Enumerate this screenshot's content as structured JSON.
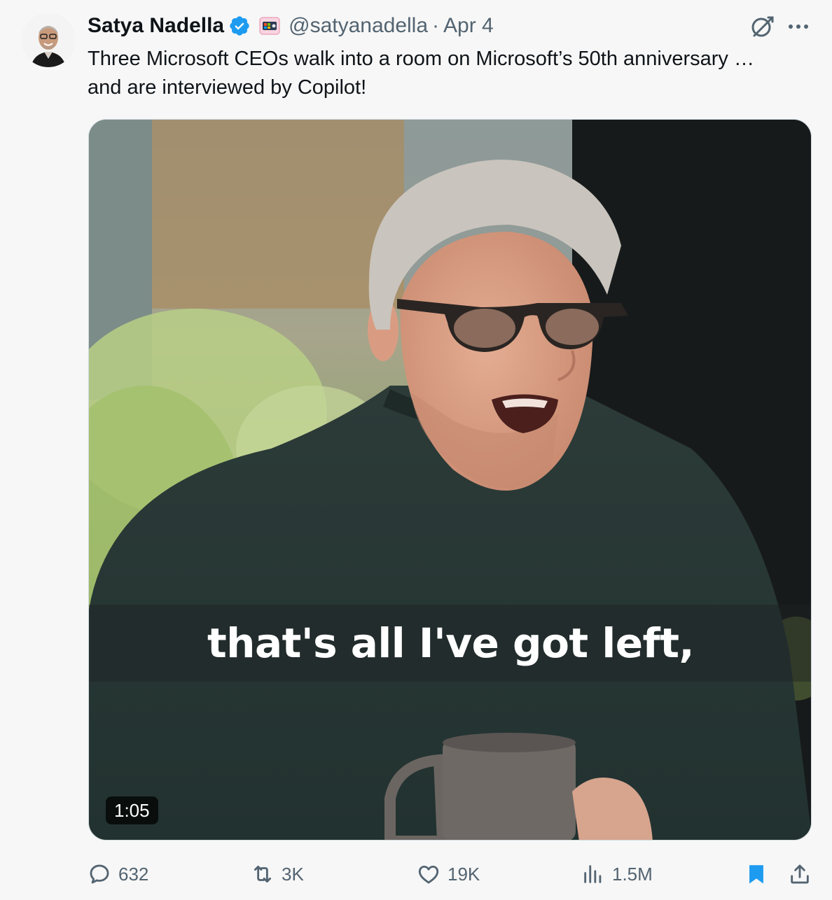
{
  "author": {
    "name": "Satya Nadella",
    "handle": "@satyanadella",
    "separator": "·",
    "date": "Apr 4"
  },
  "tweet": {
    "text": "Three Microsoft CEOs walk into a room on Microsoft’s 50th anniversary …\nand are interviewed by Copilot!"
  },
  "media": {
    "caption": "that's all I've got left,",
    "duration": "1:05"
  },
  "actions": {
    "replies": "632",
    "reposts": "3K",
    "likes": "19K",
    "views": "1.5M"
  },
  "colors": {
    "verified": "#1d9bf0",
    "muted_text": "#536471",
    "bookmark_active": "#1d9bf0"
  },
  "icons": [
    "verified-badge-icon",
    "affiliate-badge-icon",
    "grok-icon",
    "more-icon",
    "reply-icon",
    "retweet-icon",
    "like-icon",
    "views-icon",
    "bookmark-icon",
    "share-icon"
  ]
}
